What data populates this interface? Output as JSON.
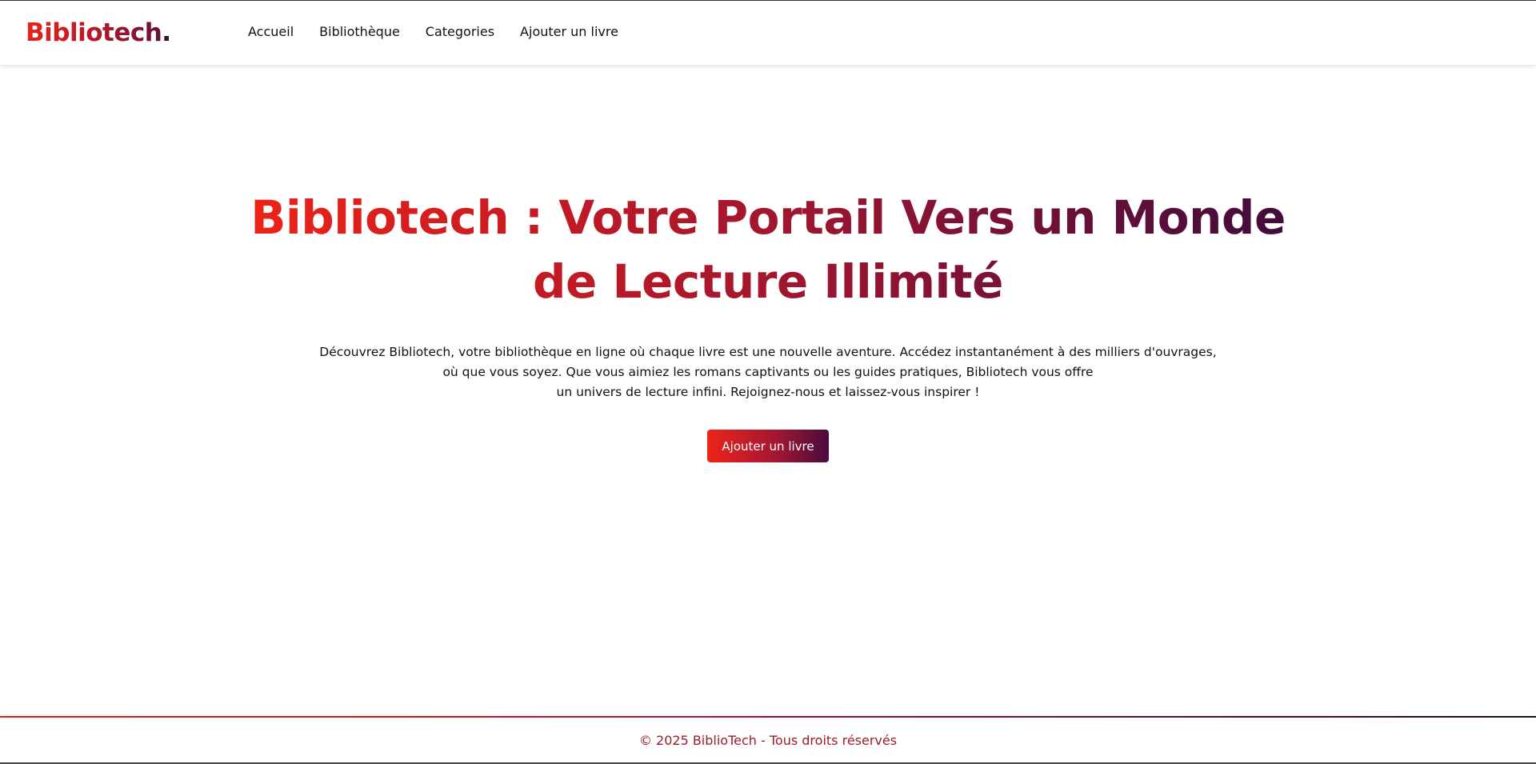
{
  "brand": {
    "name": "Bibliotech",
    "dot": "."
  },
  "nav": {
    "items": [
      {
        "label": "Accueil"
      },
      {
        "label": "Bibliothèque"
      },
      {
        "label": "Categories"
      },
      {
        "label": "Ajouter un livre"
      }
    ]
  },
  "hero": {
    "title_line1": "Bibliotech : Votre Portail Vers un Monde",
    "title_line2": "de Lecture Illimité",
    "description": [
      "Découvrez Bibliotech, votre bibliothèque en ligne où chaque livre est une nouvelle aventure. Accédez instantanément à des milliers d'ouvrages,",
      "où que vous soyez. Que vous aimiez les romans captivants ou les guides pratiques, Bibliotech vous offre",
      "un univers de lecture infini. Rejoignez-nous et laissez-vous inspirer !"
    ],
    "cta_label": "Ajouter un livre"
  },
  "footer": {
    "text": "© 2025 BiblioTech - Tous droits réservés"
  },
  "colors": {
    "gradient_start": "#ee2419",
    "gradient_mid": "#a51733",
    "gradient_end": "#3e0c3c",
    "footer_text": "#9c1d2a"
  }
}
